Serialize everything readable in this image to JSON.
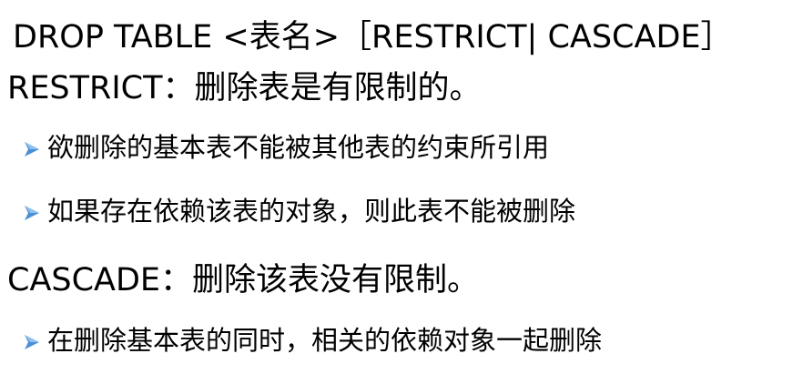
{
  "syntax": "DROP TABLE <表名>［RESTRICT| CASCADE］",
  "restrict": {
    "heading": "RESTRICT：删除表是有限制的。",
    "bullets": [
      "欲删除的基本表不能被其他表的约束所引用",
      "如果存在依赖该表的对象，则此表不能被删除"
    ]
  },
  "cascade": {
    "heading": "CASCADE：删除该表没有限制。",
    "bullets": [
      "在删除基本表的同时，相关的依赖对象一起删除"
    ]
  },
  "colors": {
    "text": "#000000",
    "bullet_arrow": "#4a8fd6"
  },
  "icons": {
    "bullet": "arrow-bullet-icon"
  }
}
